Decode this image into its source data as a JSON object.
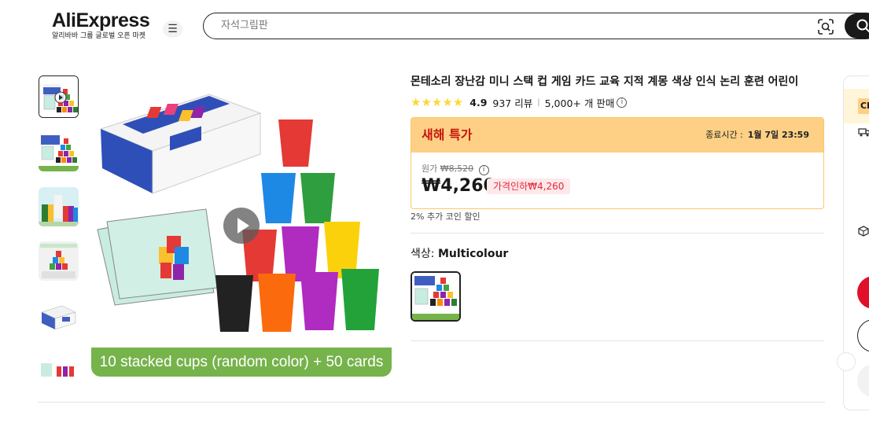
{
  "header": {
    "logo_text": "AliExpress",
    "logo_sub": "알리바바 그룹 글로벌 오픈 마켓",
    "menu_icon": "menu-icon",
    "search_placeholder": "자석그림판",
    "camera_icon": "image-search-icon",
    "search_icon": "search-icon"
  },
  "gallery": {
    "thumbnails": [
      "thumb-1",
      "thumb-2",
      "thumb-3",
      "thumb-4",
      "thumb-5",
      "thumb-6"
    ],
    "caption_text": "10 stacked cups (random color) + 50 cards",
    "play_icon": "play-icon"
  },
  "product": {
    "title": "몬테소리 장난감 미니 스택 컵 게임 카드 교육 지적 계몽 색상 인식 논리 훈련 어린이",
    "rating": 4.9,
    "rating_text": "4.9",
    "stars": 5,
    "reviews": "937 리뷰",
    "sold": "5,000+ 개 판매"
  },
  "deal": {
    "title": "새해 특가",
    "end_label": "종료시간 :",
    "end_time": "1월 7일 23:59",
    "original_label": "원가",
    "original_price": "₩8,520",
    "price": "₩4,260",
    "drop_badge": "가격인하₩4,260",
    "coin_text": "2% 추가 코인 할인"
  },
  "variant": {
    "label": "색상:",
    "value": "Multicolour"
  },
  "right_panel": {
    "badge": "Ch"
  },
  "colors": {
    "deal_header": "#fdd085",
    "deal_title": "#c5140a",
    "drop_badge_bg": "#fde8ea",
    "drop_badge_text": "#e6263b",
    "caption_bar": "#76b34b",
    "star": "#fdd835",
    "buy_button": "#e0102b"
  }
}
